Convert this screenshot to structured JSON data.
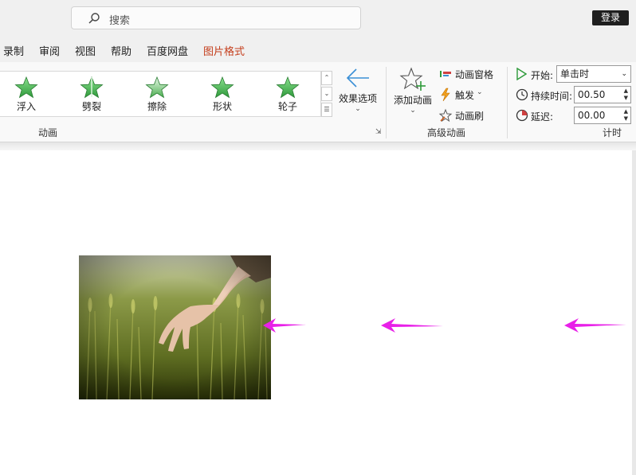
{
  "titlebar": {
    "search_placeholder": "搜索",
    "login_label": "登录"
  },
  "menu": {
    "items": [
      "录制",
      "审阅",
      "视图",
      "帮助",
      "百度网盘",
      "图片格式"
    ],
    "active": "图片格式",
    "active_color": "#c43e1c"
  },
  "ribbon": {
    "animation_gallery": {
      "items": [
        "浮入",
        "劈裂",
        "擦除",
        "形状",
        "轮子"
      ],
      "group_label": "动画"
    },
    "effect_options": {
      "label": "效果选项"
    },
    "advanced": {
      "add_animation": "添加动画",
      "animation_pane": "动画窗格",
      "trigger": "触发",
      "painter": "动画刷",
      "group_label": "高级动画"
    },
    "timing": {
      "start_label": "开始:",
      "start_value": "单击时",
      "duration_label": "持续时间:",
      "duration_value": "00.50",
      "delay_label": "延迟:",
      "delay_value": "00.00",
      "group_label": "计时"
    }
  },
  "slide": {
    "image": "wheat-field-hand-photo",
    "motion_arrows": 3,
    "arrow_color": "#e820e8"
  },
  "icons": [
    "search-icon",
    "star-icon",
    "arrow-left-icon",
    "add-star-icon",
    "pane-icon",
    "lightning-icon",
    "brush-star-icon",
    "play-icon",
    "clock-icon",
    "delay-clock-icon"
  ]
}
